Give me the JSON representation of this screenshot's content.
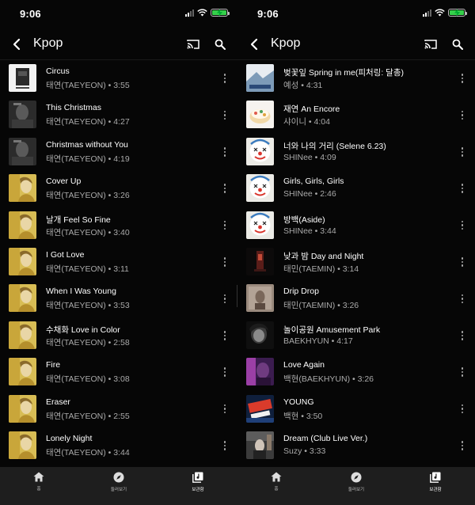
{
  "status_time": "9:06",
  "header_title": "Kpop",
  "nav": {
    "home": "홈",
    "explore": "둘러보기",
    "library": "보관함"
  },
  "left_songs": [
    {
      "title": "Circus",
      "subtitle": "태연(TAEYEON) • 3:55"
    },
    {
      "title": "This Christmas",
      "subtitle": "태연(TAEYEON) • 4:27"
    },
    {
      "title": "Christmas without You",
      "subtitle": "태연(TAEYEON) • 4:19"
    },
    {
      "title": "Cover Up",
      "subtitle": "태연(TAEYEON) • 3:26"
    },
    {
      "title": "날개 Feel So Fine",
      "subtitle": "태연(TAEYEON) • 3:40"
    },
    {
      "title": "I Got Love",
      "subtitle": "태연(TAEYEON) • 3:11"
    },
    {
      "title": "When I Was Young",
      "subtitle": "태연(TAEYEON) • 3:53"
    },
    {
      "title": "수채화 Love in Color",
      "subtitle": "태연(TAEYEON) • 2:58"
    },
    {
      "title": "Fire",
      "subtitle": "태연(TAEYEON) • 3:08"
    },
    {
      "title": "Eraser",
      "subtitle": "태연(TAEYEON) • 2:55"
    },
    {
      "title": "Lonely Night",
      "subtitle": "태연(TAEYEON) • 3:44"
    }
  ],
  "right_songs": [
    {
      "title": "벚꽃잎 Spring in me(피처링: 달총)",
      "subtitle": "예성 • 4:31"
    },
    {
      "title": "재연 An Encore",
      "subtitle": "샤이니 • 4:04"
    },
    {
      "title": "너와 나의 거리 (Selene 6.23)",
      "subtitle": "SHINee • 4:09"
    },
    {
      "title": "Girls, Girls, Girls",
      "subtitle": "SHINee • 2:46"
    },
    {
      "title": "방백(Aside)",
      "subtitle": "SHINee • 3:44"
    },
    {
      "title": "낮과 밤 Day and Night",
      "subtitle": "태민(TAEMIN) • 3:14"
    },
    {
      "title": "Drip Drop",
      "subtitle": "태민(TAEMIN) • 3:26"
    },
    {
      "title": "놀이공원 Amusement Park",
      "subtitle": "BAEKHYUN • 4:17"
    },
    {
      "title": "Love Again",
      "subtitle": "백현(BAEKHYUN) • 3:26"
    },
    {
      "title": "YOUNG",
      "subtitle": "백현 • 3:50"
    },
    {
      "title": "Dream (Club Live Ver.)",
      "subtitle": "Suzy • 3:33"
    }
  ],
  "thumb_art": {
    "left": [
      "circus-art",
      "dark-portrait-art",
      "dark-portrait-art",
      "yellow-portrait-art",
      "yellow-portrait-art",
      "yellow-portrait-art",
      "yellow-portrait-art",
      "yellow-portrait-art",
      "yellow-portrait-art",
      "yellow-portrait-art",
      "yellow-portrait-art"
    ],
    "right": [
      "spring-art",
      "cake-art",
      "clown-art",
      "clown-art",
      "clown-art",
      "dark-red-art",
      "taupe-art",
      "mono-portrait-art",
      "purple-portrait-art",
      "young-art",
      "street-art"
    ]
  },
  "colors": {
    "background": "#060606",
    "secondary_text": "#aaaaaa",
    "nav_bg": "#1e1e1e",
    "battery": "#35d04a"
  }
}
